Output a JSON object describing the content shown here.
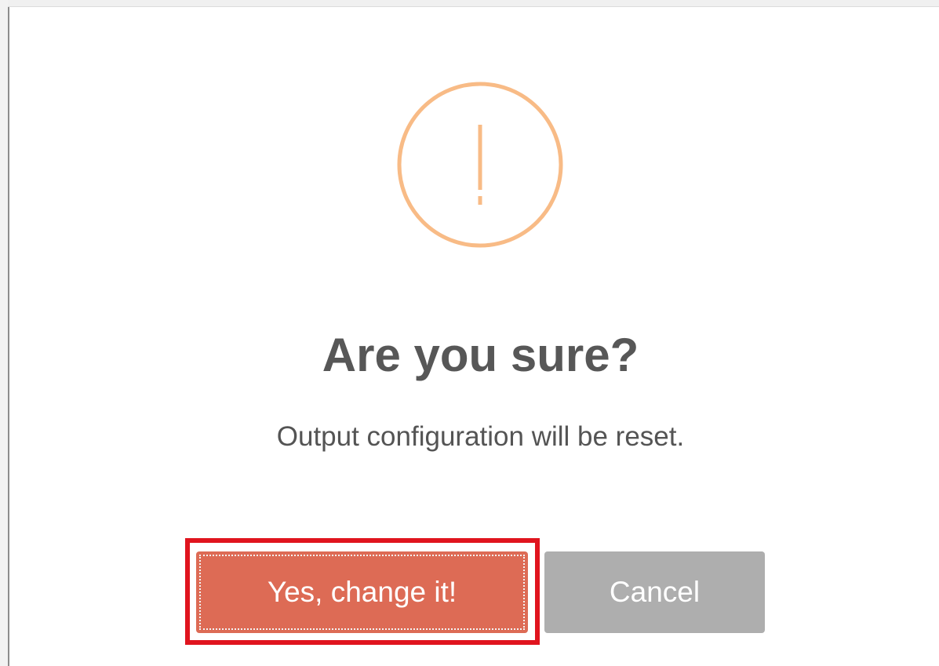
{
  "dialog": {
    "icon": "warning-exclamation-icon",
    "icon_color": "#f8bb86",
    "title": "Are you sure?",
    "message": "Output configuration will be reset.",
    "confirm_label": "Yes, change it!",
    "confirm_color": "#dd6b55",
    "cancel_label": "Cancel",
    "cancel_color": "#aeaeae",
    "highlight_color": "#e0141e"
  }
}
